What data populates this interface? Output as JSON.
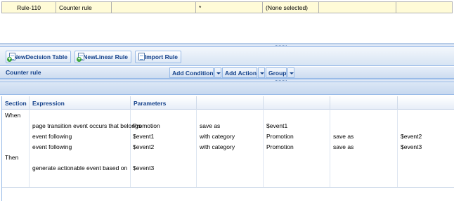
{
  "top_row": {
    "id": "Rule-110",
    "name": "Counter rule",
    "col3": "",
    "col4": "*",
    "col5": "(None selected)",
    "col6": "",
    "col7": ""
  },
  "toolbar": {
    "new_decision_table": "NewDecision Table",
    "new_linear_rule": "NewLinear Rule",
    "import_rule": "Import Rule"
  },
  "rulebar": {
    "rule_name": "Counter rule",
    "add_condition": "Add Condition",
    "add_action": "Add Action",
    "group": "Group"
  },
  "grid": {
    "headers": [
      "Section",
      "Expression",
      "Parameters",
      "",
      "",
      "",
      ""
    ],
    "sections": {
      "when": "When",
      "then": "Then"
    },
    "rows": [
      [
        "page transition event occurs that belongs",
        "Promotion",
        "save as",
        "$event1",
        "",
        ""
      ],
      [
        "event following",
        "$event1",
        "with category",
        "Promotion",
        "save as",
        "$event2"
      ],
      [
        "event following",
        "$event2",
        "with category",
        "Promotion",
        "save as",
        "$event3"
      ],
      [
        "generate actionable event based on",
        "$event3",
        "",
        "",
        "",
        ""
      ]
    ]
  },
  "colors": {
    "top_row_bg": "#fffbd7",
    "header_text": "#15428b",
    "border": "#99bbe8"
  }
}
